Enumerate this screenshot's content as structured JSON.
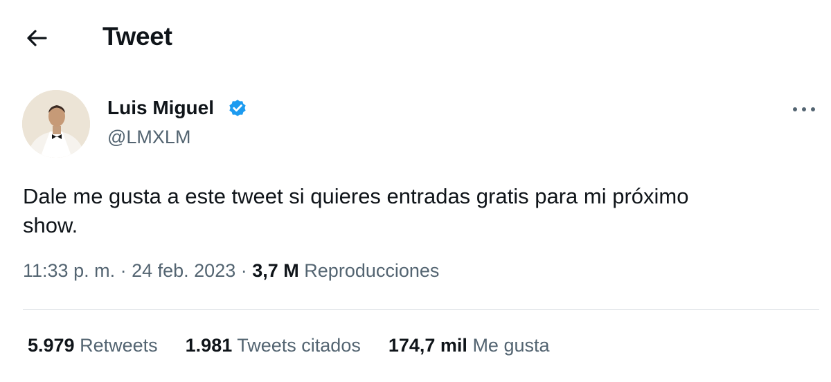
{
  "header": {
    "title": "Tweet",
    "back_icon": "arrow-left-icon"
  },
  "author": {
    "name": "Luis Miguel",
    "handle": "@LMXLM",
    "verified": true,
    "verified_color": "#1d9bf0"
  },
  "tweet": {
    "text_line1": "Dale me gusta a este tweet si quieres entradas gratis para mi próximo",
    "text_line2": "show.",
    "time": "11:33 p. m.",
    "date": "24 feb. 2023",
    "separator": "·",
    "views_count": "3,7 M",
    "views_label": "Reproducciones"
  },
  "stats": {
    "retweets_count": "5.979",
    "retweets_label": "Retweets",
    "quotes_count": "1.981",
    "quotes_label": "Tweets citados",
    "likes_count": "174,7 mil",
    "likes_label": "Me gusta"
  },
  "icons": {
    "more": "more-horizontal-icon",
    "verified": "verified-badge-icon"
  }
}
